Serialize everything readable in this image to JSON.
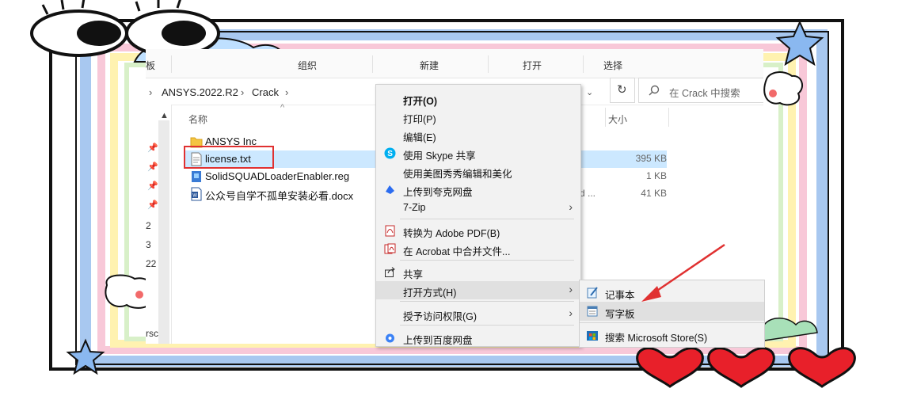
{
  "ribbon": {
    "items": [
      "板",
      "组织",
      "新建",
      "打开",
      "选择"
    ]
  },
  "address": {
    "crumbs": [
      "ANSYS.2022.R2",
      "Crack"
    ],
    "search_placeholder": "在 Crack 中搜索"
  },
  "columns": {
    "name": "名称",
    "size": "大小"
  },
  "nav_marks": [
    "2",
    "3",
    "22",
    "rsc"
  ],
  "files": [
    {
      "name": "ANSYS Inc",
      "size": "",
      "icon": "folder-icon"
    },
    {
      "name": "license.txt",
      "size": "395 KB",
      "icon": "text-file-icon"
    },
    {
      "name": "SolidSQUADLoaderEnabler.reg",
      "size": "1 KB",
      "icon": "registry-file-icon"
    },
    {
      "name": "公众号自学不孤单安装必看.docx",
      "size": "41 KB",
      "type_fragment": "d ...",
      "icon": "word-file-icon"
    }
  ],
  "context_menu": {
    "items": [
      {
        "label": "打开(O)"
      },
      {
        "label": "打印(P)"
      },
      {
        "label": "编辑(E)"
      },
      {
        "label": "使用 Skype 共享",
        "icon": "skype-icon"
      },
      {
        "label": "使用美图秀秀编辑和美化"
      },
      {
        "label": "上传到夸克网盘",
        "icon": "quark-icon"
      },
      {
        "label": "7-Zip"
      },
      {
        "label": "转换为 Adobe PDF(B)",
        "icon": "pdf-icon"
      },
      {
        "label": "在 Acrobat 中合并文件...",
        "icon": "acrobat-icon"
      },
      {
        "label": "共享",
        "icon": "share-icon"
      },
      {
        "label": "打开方式(H)"
      },
      {
        "label": "授予访问权限(G)"
      },
      {
        "label": "上传到百度网盘",
        "icon": "baidu-icon"
      }
    ]
  },
  "submenu": {
    "items": [
      {
        "label": "记事本",
        "icon": "notepad-icon"
      },
      {
        "label": "写字板",
        "icon": "wordpad-icon"
      },
      {
        "label": "搜索 Microsoft Store(S)",
        "icon": "store-icon"
      }
    ]
  },
  "colors": {
    "selection": "#cce8ff",
    "highlight_box": "#e03131",
    "arrow": "#e03131"
  }
}
